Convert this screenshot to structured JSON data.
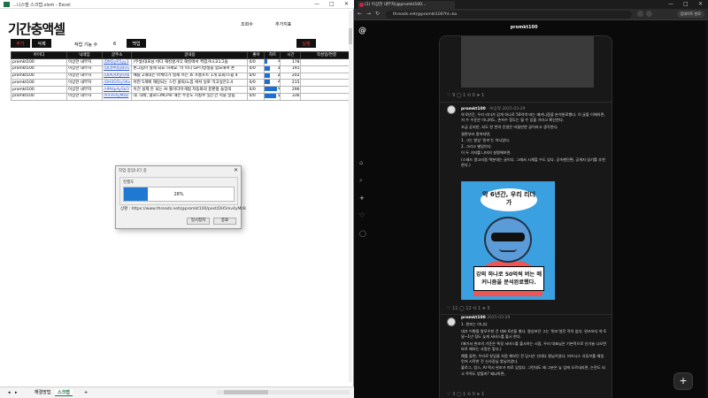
{
  "excel": {
    "title": "...니스텔 스크랩.xlsm - Excel",
    "window_controls": [
      "—",
      "□",
      "✕"
    ],
    "logo": "기간충액셀",
    "views_label": "조회수",
    "add_label": "추가지표",
    "buttons": {
      "add": "추가",
      "delete": "삭제",
      "setting": "백업",
      "run": "실행"
    },
    "work_label": "작업 기능 수",
    "work_value": "6",
    "table": {
      "headers": [
        "아이디",
        "닉네임",
        "글주소",
        "글내용",
        "좋아",
        "하트",
        "시간",
        "작성일/연결"
      ],
      "rows": [
        [
          "promkt100",
          "이상한 내부자",
          "/DM2yR5yy3",
          "(무생)대표님 바다 해킹할거다 해킹에서 쩍힘거니고1그들",
          "0/0",
          "1",
          "178",
          ""
        ],
        [
          "promkt100",
          "이상한 내부자",
          "/DLtPAdyBvG",
          "손그림이 실제 되요 하세요. 이 미니 GPT)방생을 합요해서 손",
          "0/0",
          "3",
          "191",
          ""
        ],
        [
          "promkt100",
          "이상한 내부자",
          "/DIAOUfyHn6",
          "예를 2개대는 마케터가 실제 쓰는 쇼 프롬프트 1개 후회/스쉽 4",
          "0/0",
          "2",
          "202",
          ""
        ],
        [
          "promkt100",
          "이상한 내부자",
          "/DH0D5ty5Kx",
          "어떤 5개에 해당되는 스킨 클릭/느낌 써서 닐로 막고싶은2.4",
          "0/0",
          "2",
          "215",
          ""
        ],
        [
          "promkt100",
          "이상한 내부자",
          "/HMdpAySkO",
          "이건 실제 돈 되는 AI 툴이다아게됨 자동화의 끝판왕 들장의",
          "0/0",
          "5",
          "296",
          ""
        ],
        [
          "promkt100",
          "이상한 내부자",
          "/hmm4yMzD",
          "대. 대박, 클로드MCP로 해든 주문도 시킬수 있는건 저들 달림",
          "0/0",
          "5",
          "336",
          ""
        ]
      ],
      "heart_levels": [
        0.2,
        0.4,
        0.35,
        0.35,
        0.9,
        0.8
      ]
    },
    "sheets": [
      "해결방법",
      "스크랩"
    ],
    "active_sheet": "스크랩",
    "add_sheet": "+",
    "scroll_left": "◂",
    "scroll_right": "▸"
  },
  "dialog": {
    "title": "작업 중입니다 중",
    "close": "✕",
    "group_label": "진행도",
    "progress_text": "28%",
    "progress_value": 0.22,
    "status_label": "상황 :",
    "status_url": "https://www.threads.net/@promkt100/post/DH5mv4yMc8",
    "pause_button": "일시정지",
    "close_button": "종료"
  },
  "browser": {
    "tab_title": "(1) 이상한 내부자(@promkt100...",
    "tab_close": "✕",
    "address": "threads.net/@promkt100?hl=ko",
    "nav": [
      "←",
      "→",
      "↻"
    ],
    "update_button": "업데이트 완료",
    "window_controls": [
      "—",
      "□",
      "✕"
    ]
  },
  "threads": {
    "profile_header": "promkt100",
    "nav_icons": [
      "home-icon",
      "search-icon",
      "create-icon",
      "activity-icon",
      "profile-icon"
    ],
    "post1_actions": "♡ 9   ◯ 1   ⟲ 0   ➤ 1",
    "post2": {
      "username": "promkt100",
      "meta": "· AI공략  2025-03-29",
      "paragraphs": [
        "약 6년간, 우리 리더가 감게 하나로 50억씩 버는 메커니즘을 분석완료했다. 이 글을 이해하면, 저 수 수준은 아니여도, 손저수 정도는 될 수 있을 거라고 확신한다.",
        "조금 공지만, 되도 한 번의 인생은 바꿀만한 글이라고 생각한다.",
        "결론부터 말하자면,",
        "1. 그는 항상 '왼조'는 아니었다.",
        "2. 그리고 별업이다.",
        "이 두 가지를 나머지 설명해보면.",
        "(스레드 알고리즘 백분대는 글이다. 그래서 시체할 수도 있다. 공속팬단편, 공개지 읽기를 추천한다.)"
      ],
      "image_bubble": "약 6년간, 우리 리더가",
      "image_caption": "강의 하나로 50억씩 버는 메커니즘을 분석완료했다.",
      "actions": "♡ 11   ◯ 12   ⟲ 1   ➤ 5"
    },
    "post3": {
      "username": "promkt100",
      "meta": "  2025-03-29",
      "paragraphs": [
        "1. 왼조는 아니다",
        "대가 어떻을 왕모우한 건 대비 6년을 벌다. 왕상보던 그는 '왼조'였던 적이 없다. 왼조보다 약 6달~1년 정도 늦게 서비스를 출시 한다.",
        "(애기서 왼조의 기준은 특정 서비스를 출시하는 시점, 우리 대표님은 기본적으로 신기술 나오면 바로 해보는 사람은 맞다.)",
        "예를 들면, 우리로 창업을 처음 해보던 전 당시은 선대다 왕님이었다. 비즈니스 유튜브를 제일 먼저 시작한 건 신사장님 왕님이었다.",
        "블로그, 링스, AI 역시 왼조가 따로 있었다. 그런데도 왜 그분은 늦 업에 오르네지면, 논란도 되고 주목도 받을까? 왜냐하면,"
      ],
      "actions": "♡ 3   ◯ 1   ⟲ 0   ➤ 1"
    },
    "fab": "+"
  }
}
